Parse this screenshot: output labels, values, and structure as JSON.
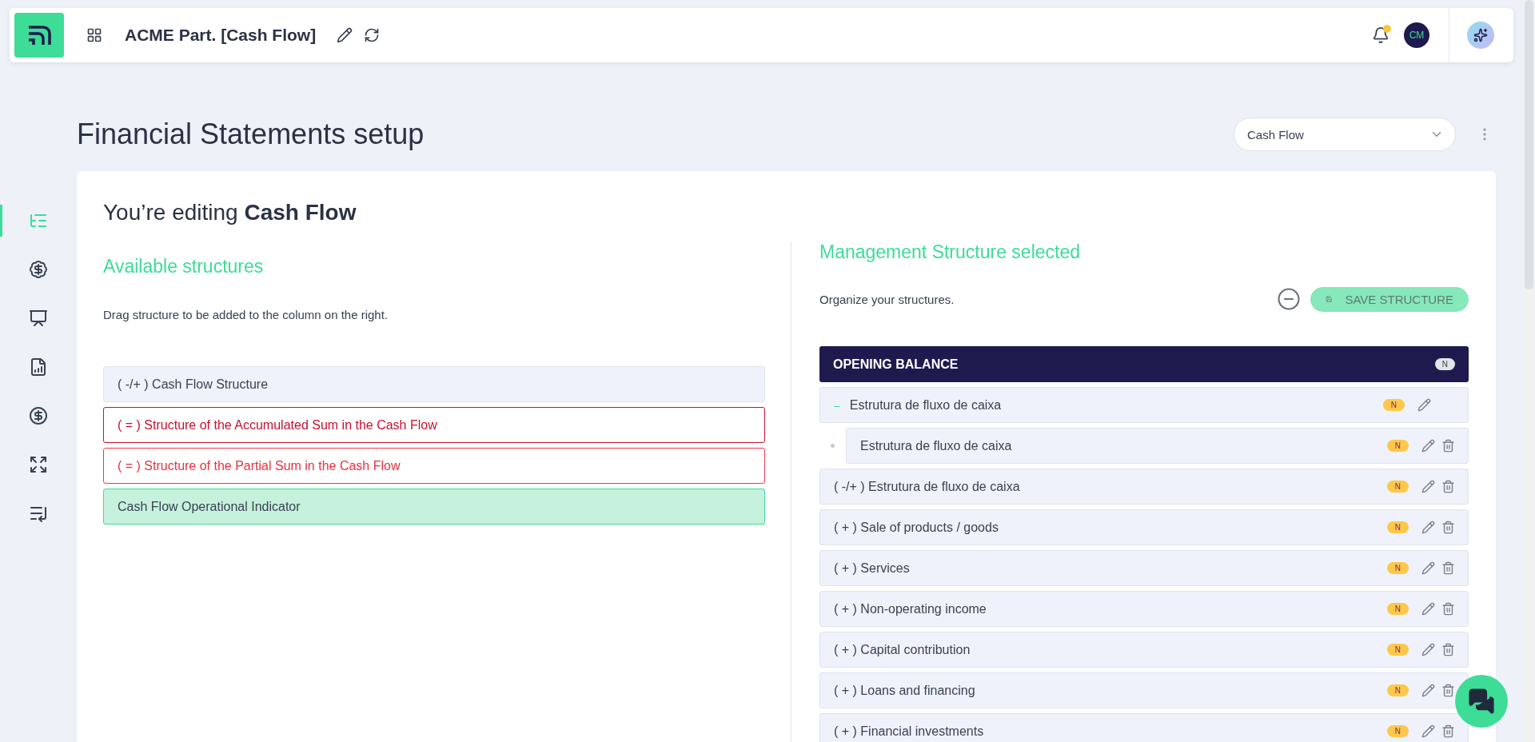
{
  "header": {
    "title": "ACME Part. [Cash Flow]",
    "avatar": "CM"
  },
  "page": {
    "title": "Financial Statements setup",
    "select": {
      "value": "Cash Flow"
    }
  },
  "sidebar": {
    "items": [
      {
        "selected": true
      },
      {
        "selected": false
      },
      {
        "selected": false
      },
      {
        "selected": false
      },
      {
        "selected": false
      },
      {
        "selected": false
      },
      {
        "selected": false
      }
    ]
  },
  "editing": {
    "prefix": "You’re editing",
    "name": "Cash Flow"
  },
  "available": {
    "heading": "Available structures",
    "hint": "Drag structure to be added to the column on the right.",
    "items": [
      {
        "label": "( -/+ ) Cash Flow Structure",
        "kind": "neutral"
      },
      {
        "label": "( = ) Structure of the Accumulated Sum in the Cash Flow",
        "kind": "accumulated"
      },
      {
        "label": "( = ) Structure of the Partial Sum in the Cash Flow",
        "kind": "partial"
      },
      {
        "label": "Cash Flow Operational Indicator",
        "kind": "indicator"
      }
    ]
  },
  "selected": {
    "heading": "Management Structure selected",
    "hint": "Organize your structures.",
    "save": {
      "label": "SAVE STRUCTURE",
      "disabled": true
    },
    "section": {
      "label": "OPENING BALANCE",
      "badge": "N"
    },
    "rows": [
      {
        "label": "Estrutura de fluxo de caixa",
        "badge": "N",
        "kind": "group",
        "toggle": "–"
      },
      {
        "label": "Estrutura de fluxo de caixa",
        "badge": "N",
        "kind": "child"
      },
      {
        "label": "( -/+ ) Estrutura de fluxo de caixa",
        "badge": "N",
        "kind": "item"
      },
      {
        "label": "( + ) Sale of products / goods",
        "badge": "N",
        "kind": "item"
      },
      {
        "label": "( + ) Services",
        "badge": "N",
        "kind": "item"
      },
      {
        "label": "( + ) Non-operating income",
        "badge": "N",
        "kind": "item"
      },
      {
        "label": "( + ) Capital contribution",
        "badge": "N",
        "kind": "item"
      },
      {
        "label": "( + ) Loans and financing",
        "badge": "N",
        "kind": "item"
      },
      {
        "label": "( + ) Financial investments",
        "badge": "N",
        "kind": "item"
      }
    ]
  }
}
